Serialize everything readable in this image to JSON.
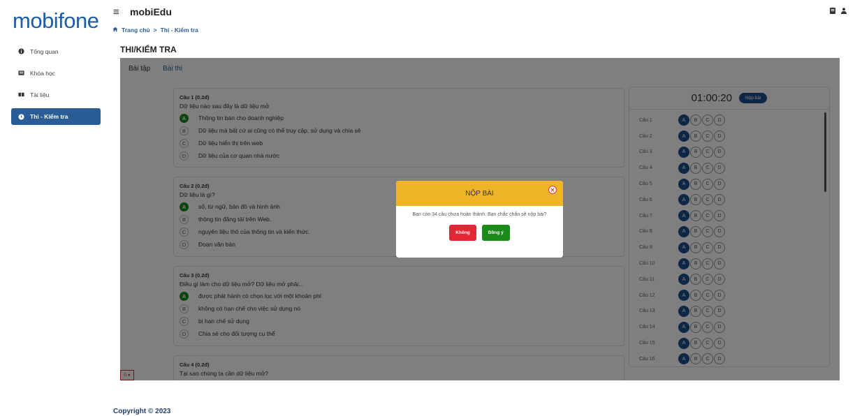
{
  "logo": "mobifone",
  "sidebar": {
    "items": [
      {
        "label": "Tổng quan",
        "active": false
      },
      {
        "label": "Khóa học",
        "active": false
      },
      {
        "label": "Tài liệu",
        "active": false
      },
      {
        "label": "Thi - Kiểm tra",
        "active": true
      }
    ]
  },
  "header": {
    "title": "mobiEdu",
    "breadcrumb": {
      "home": "Trang chủ",
      "separator": ">",
      "current": "Thi - Kiểm tra"
    }
  },
  "page_title": "THI/KIỂM TRA",
  "tabs": [
    "Bài tập",
    "Bài thi"
  ],
  "questions": [
    {
      "title": "Câu 1 (0.2đ)",
      "text": "Dữ liệu nào sau đây là dữ liệu mở",
      "options": [
        {
          "key": "A",
          "text": "Thông tin bán cho doanh nghiệp",
          "selected": true
        },
        {
          "key": "B",
          "text": "Dữ liệu mà bất cứ ai cũng có thể truy cập, sử dụng và chia sẻ",
          "selected": false
        },
        {
          "key": "C",
          "text": "Dữ liệu hiển thị trên web",
          "selected": false
        },
        {
          "key": "D",
          "text": "Dữ liệu của cơ quan nhà nước",
          "selected": false
        }
      ]
    },
    {
      "title": "Câu 2 (0.2đ)",
      "text": "Dữ liệu là gì?",
      "options": [
        {
          "key": "A",
          "text": "số, từ ngữ, bản đồ và hình ảnh",
          "selected": true
        },
        {
          "key": "B",
          "text": "thông tin đăng tải trên Web.",
          "selected": false
        },
        {
          "key": "C",
          "text": "nguyên liệu thô của thông tin và kiến thức.",
          "selected": false
        },
        {
          "key": "D",
          "text": "Đoạn văn bản",
          "selected": false
        }
      ]
    },
    {
      "title": "Câu 3 (0.2đ)",
      "text": "Điều gì làm cho dữ liệu mở? Dữ liệu mở phải...",
      "options": [
        {
          "key": "A",
          "text": "được phát hành có chọn lọc với một khoản phí",
          "selected": true
        },
        {
          "key": "B",
          "text": "không có hạn chế cho việc sử dụng nó",
          "selected": false
        },
        {
          "key": "C",
          "text": "bị hạn chế sử dụng",
          "selected": false
        },
        {
          "key": "D",
          "text": "Chia sẻ cho đối tượng cụ thể",
          "selected": false
        }
      ]
    },
    {
      "title": "Câu 4 (0.2đ)",
      "text": "Tại sao chúng ta cần dữ liệu mở?",
      "options": []
    }
  ],
  "panel": {
    "timer": "01:00:20",
    "submit_label": "Nộp bài",
    "rows": [
      "Câu 1",
      "Câu 2",
      "Câu 3",
      "Câu 4",
      "Câu 5",
      "Câu 6",
      "Câu 7",
      "Câu 8",
      "Câu 9",
      "Câu 10",
      "Câu 11",
      "Câu 12",
      "Câu 13",
      "Câu 14",
      "Câu 15",
      "Câu 16"
    ],
    "choices": [
      "A",
      "B",
      "C",
      "D"
    ],
    "selected": "A"
  },
  "mini_badge": "0 ●",
  "modal": {
    "title": "NỘP BÀI",
    "message": "Bạn còn 34 câu chưa hoàn thành. Bạn chắc chắn sẽ nộp bài?",
    "no_label": "Không",
    "yes_label": "Đồng ý"
  },
  "colors": {
    "brand": "#1a5ea8",
    "active_nav": "#2a5d96",
    "modal_header": "#f0b429",
    "yes": "#1a8a1a",
    "no": "#e32636"
  },
  "footer": {
    "copyright": "Copyright © 2023"
  }
}
